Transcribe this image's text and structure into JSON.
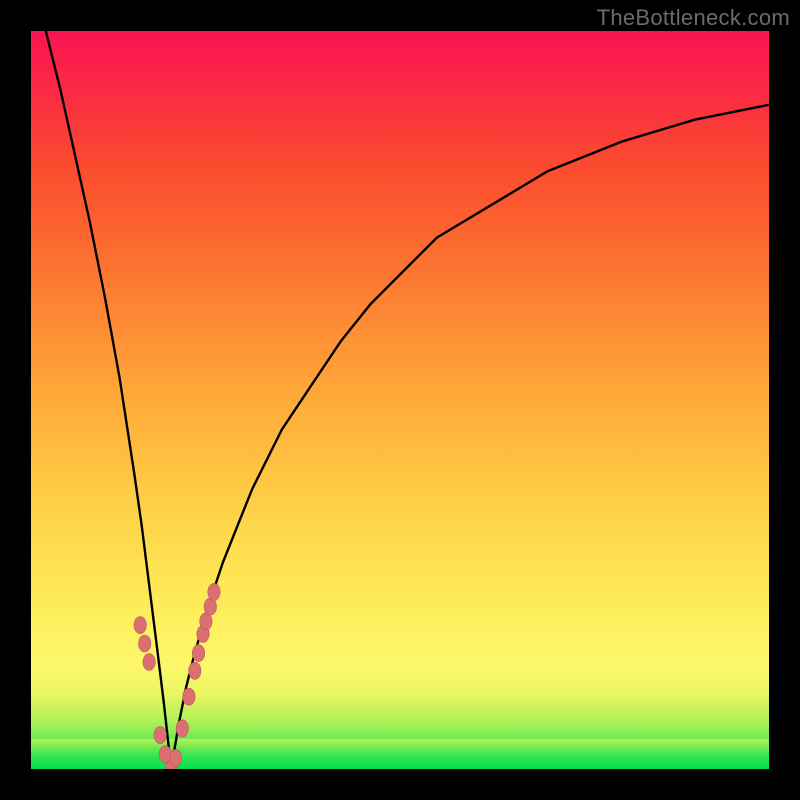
{
  "watermark": "TheBottleneck.com",
  "colors": {
    "frame": "#000000",
    "curve": "#000000",
    "dot_fill": "#db6f72",
    "dot_stroke": "#b9585b",
    "gradient_top": "#fa1452",
    "gradient_bottom": "#04e24e"
  },
  "chart_data": {
    "type": "line",
    "title": "",
    "xlabel": "",
    "ylabel": "",
    "xlim": [
      0,
      100
    ],
    "ylim": [
      0,
      100
    ],
    "notes": "V-shaped curve on a red-to-green vertical gradient background. Minimum (0) near x≈19. Values estimated from pixel position against a 0–100 vertical scale (0 at bottom / green, 100 at top / red).",
    "series": [
      {
        "name": "curve",
        "x": [
          2,
          4,
          6,
          8,
          10,
          12,
          14,
          15,
          16,
          17,
          18,
          19,
          20,
          21,
          22,
          24,
          26,
          28,
          30,
          34,
          38,
          42,
          46,
          50,
          55,
          60,
          65,
          70,
          75,
          80,
          85,
          90,
          95,
          100
        ],
        "values": [
          100,
          92,
          83,
          74,
          64,
          53,
          40,
          33,
          25,
          17,
          9,
          0,
          6,
          11,
          15,
          22,
          28,
          33,
          38,
          46,
          52,
          58,
          63,
          67,
          72,
          75,
          78,
          81,
          83,
          85,
          86.5,
          88,
          89,
          90
        ]
      },
      {
        "name": "dots",
        "x": [
          14.8,
          15.4,
          16.0,
          17.5,
          18.2,
          19.0,
          19.6,
          20.5,
          21.4,
          22.2,
          22.7,
          23.3,
          23.7,
          24.3,
          24.8
        ],
        "values": [
          19.5,
          17.0,
          14.5,
          4.6,
          2.0,
          0.0,
          1.5,
          5.5,
          9.8,
          13.3,
          15.7,
          18.3,
          20.0,
          22.0,
          24.0
        ]
      }
    ]
  }
}
